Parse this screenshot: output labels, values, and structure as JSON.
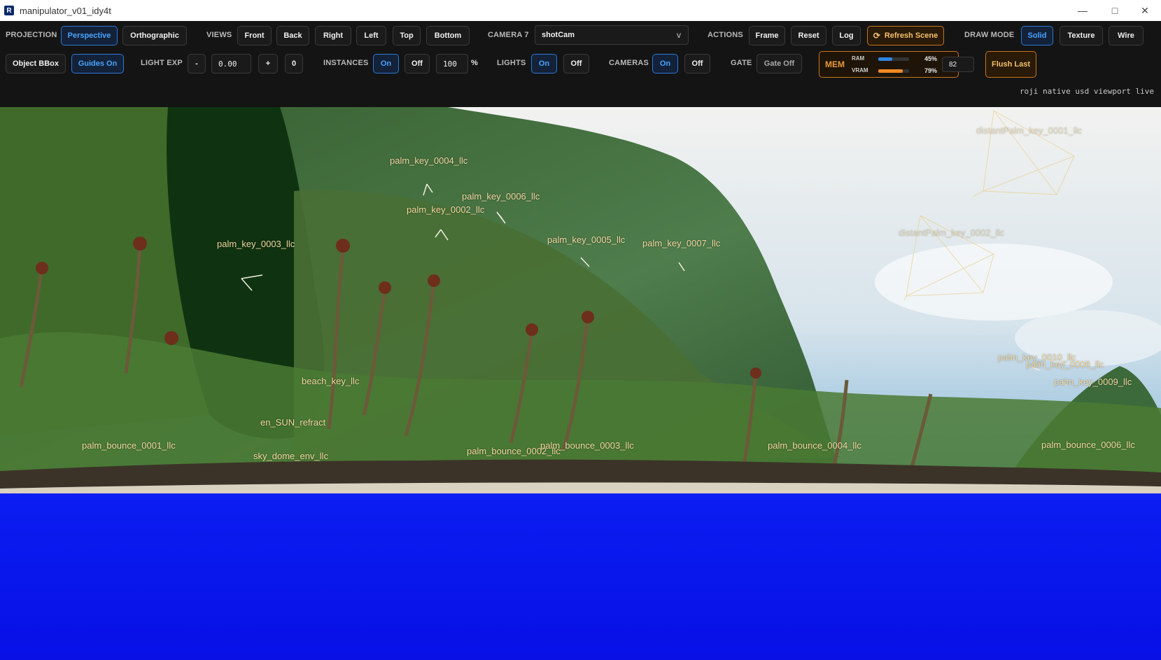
{
  "window": {
    "title": "manipulator_v01_idy4t",
    "icon": "R",
    "controls": [
      "minimize-icon",
      "maximize-icon",
      "close-icon"
    ]
  },
  "toolbar": {
    "projection": {
      "label": "PROJECTION",
      "perspective": "Perspective",
      "orthographic": "Orthographic",
      "active": "Perspective"
    },
    "views": {
      "label": "VIEWS",
      "front": "Front",
      "back": "Back",
      "right": "Right",
      "left": "Left",
      "top": "Top",
      "bottom": "Bottom"
    },
    "camera": {
      "label": "CAMERA 7",
      "value": "shotCam",
      "chevron": "v"
    },
    "actions": {
      "label": "ACTIONS",
      "frame": "Frame",
      "reset": "Reset",
      "log": "Log",
      "refresh": "Refresh Scene",
      "refresh_icon": "⟳"
    },
    "draw_mode": {
      "label": "DRAW MODE",
      "solid": "Solid",
      "texture": "Texture",
      "wire": "Wire",
      "active": "Solid"
    },
    "bbox": "Object BBox",
    "guides": "Guides On",
    "light_exp": {
      "label": "LIGHT EXP",
      "minus": "-",
      "value": "0.00",
      "plus": "+",
      "zero": "0"
    },
    "instances": {
      "label": "INSTANCES",
      "on": "On",
      "off": "Off",
      "percent": "100",
      "percent_sign": "%",
      "active": "On"
    },
    "lights": {
      "label": "LIGHTS",
      "on": "On",
      "off": "Off",
      "active": "On"
    },
    "cameras": {
      "label": "CAMERAS",
      "on": "On",
      "off": "Off",
      "active": "On"
    },
    "gate": {
      "label": "GATE",
      "button": "Gate Off"
    },
    "mem": {
      "label": "MEM",
      "ram_label": "RAM",
      "ram_pct": "45%",
      "ram_value": 0.45,
      "ram_color": "#2f86e0",
      "vram_label": "VRAM",
      "vram_pct": "79%",
      "vram_value": 0.79,
      "vram_color": "#f08a24",
      "field": "82"
    },
    "flush": "Flush Last",
    "status": "roji native usd viewport live"
  },
  "viewport": {
    "labels": [
      "palm_key_0004_llc",
      "palm_key_0006_llc",
      "palm_key_0002_llc",
      "palm_key_0003_llc",
      "palm_key_0005_llc",
      "palm_key_0007_llc",
      "distantPalm_key_0001_llc",
      "distantPalm_key_0002_llc",
      "beach_key_llc",
      "en_SUN_refract",
      "palm_bounce_0001_llc",
      "sky_dome_env_llc",
      "palm_bounce_0002_llc",
      "palm_bounce_0003_llc",
      "palm_bounce_0004_llc",
      "palm_bounce_0006_llc",
      "palm_key_0010_llc",
      "palm_key_0008_llc",
      "palm_key_0009_llc"
    ],
    "colors": {
      "ocean": "#0a14ee",
      "sky": "#dce7ee",
      "foliage_dark": "#153a12",
      "mountain": "#3f6a3c",
      "guide": "#e9cf8e"
    }
  }
}
